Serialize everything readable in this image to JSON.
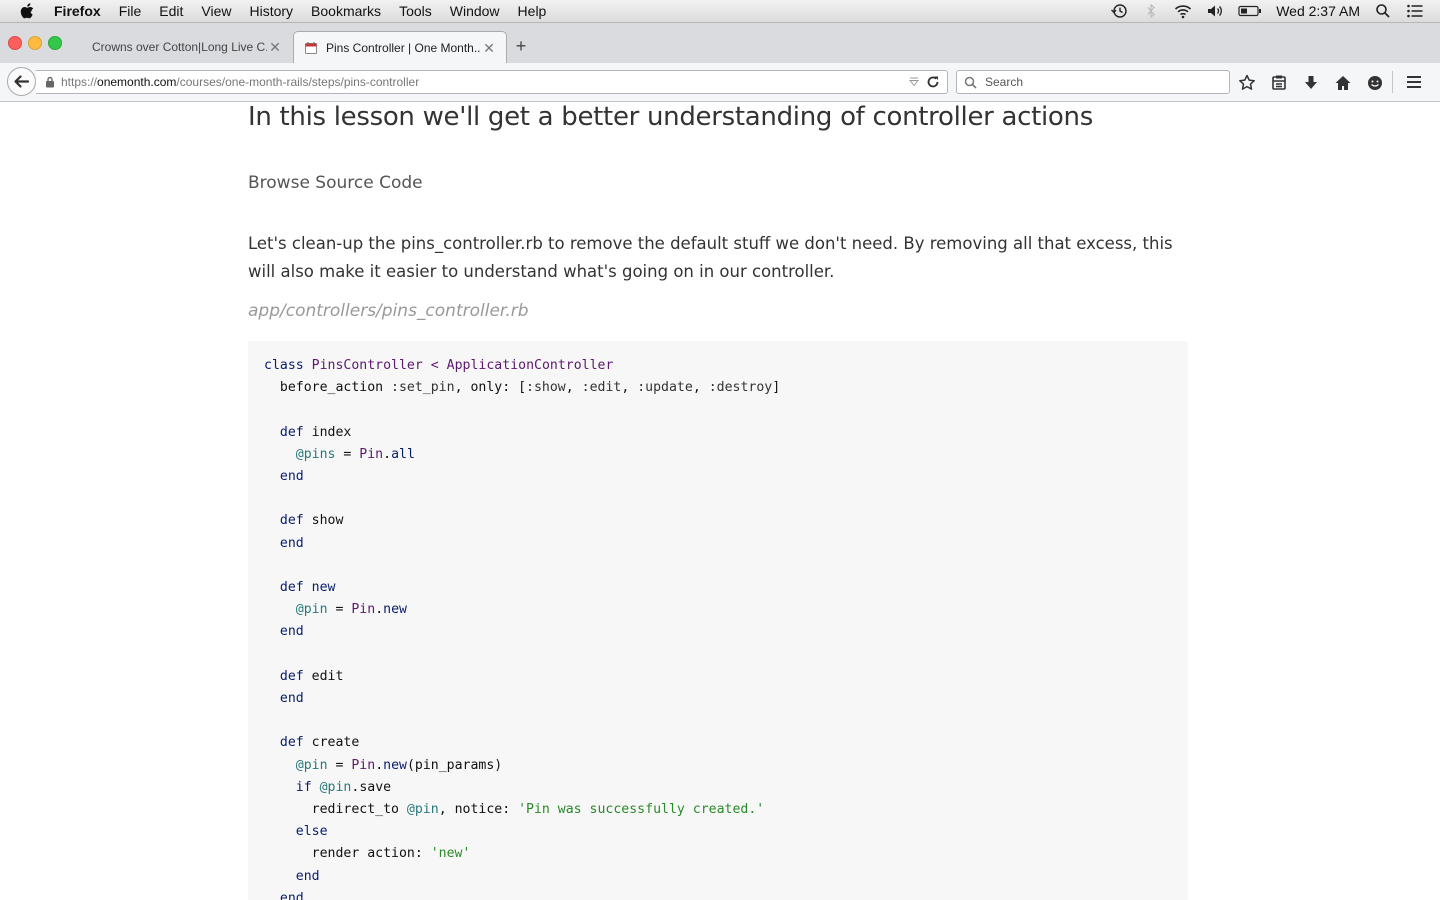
{
  "menubar": {
    "app": "Firefox",
    "items": [
      "File",
      "Edit",
      "View",
      "History",
      "Bookmarks",
      "Tools",
      "Window",
      "Help"
    ],
    "clock": "Wed 2:37 AM"
  },
  "tabs": [
    {
      "title": "Crowns over Cotton|Long Live C...",
      "active": false
    },
    {
      "title": "Pins Controller | One Month...",
      "active": true
    }
  ],
  "nav": {
    "url_prefix": "https://",
    "url_domain": "onemonth.com",
    "url_path": "/courses/one-month-rails/steps/pins-controller",
    "search_placeholder": "Search"
  },
  "page": {
    "title": "In this lesson we'll get a better understanding of controller actions",
    "browse_link": "Browse Source Code",
    "paragraph": "Let's clean-up the pins_controller.rb to remove the default stuff we don't need. By removing all that excess, this will also make it easier to understand what's going on in our controller.",
    "file_path": "app/controllers/pins_controller.rb"
  },
  "colors": {
    "keyword": "#0b1d6b",
    "constant": "#5b1a6e",
    "instance_var": "#2a7a7a",
    "string": "#2a8a2a",
    "code_background": "#f7f7f7"
  }
}
